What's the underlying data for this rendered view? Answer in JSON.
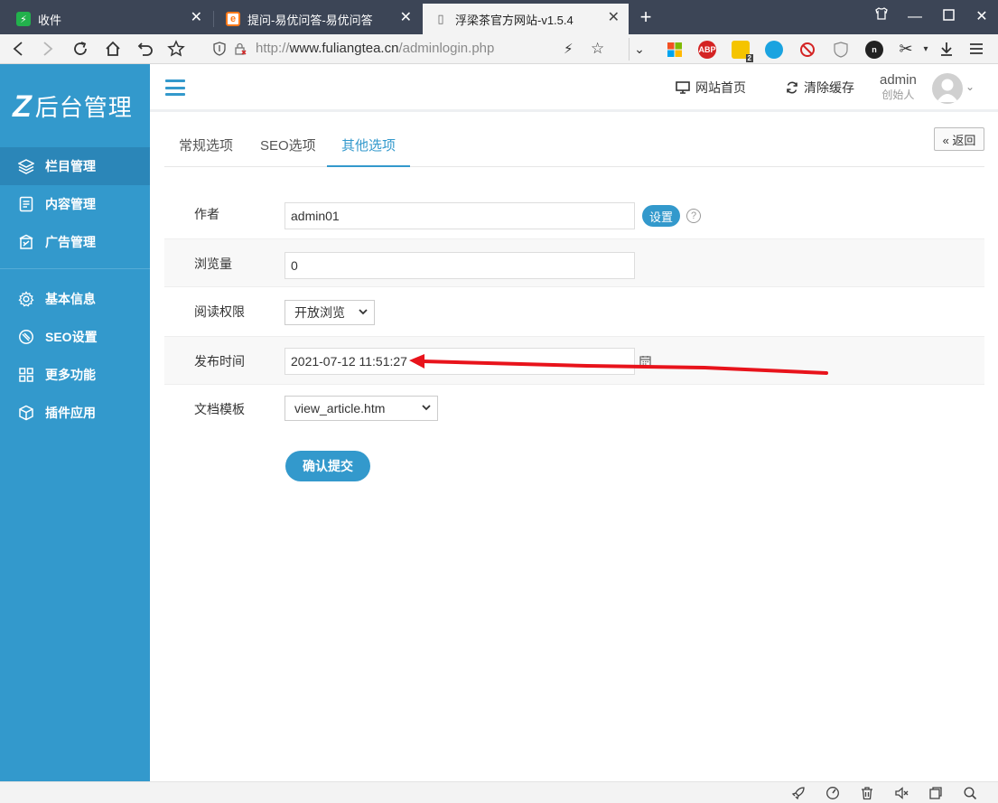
{
  "browser": {
    "tabs": [
      {
        "title": "收件",
        "favicon_color": "#22b14c",
        "favicon_glyph": "⚡"
      },
      {
        "title": "提问-易优问答-易优问答",
        "favicon_color": "#ff7a1a",
        "favicon_glyph": "e"
      },
      {
        "title": "浮梁茶官方网站-v1.5.4",
        "favicon_color": "#ffffff",
        "favicon_glyph": "▯"
      }
    ],
    "url_scheme": "http://",
    "url_host": "www.fuliangtea.cn",
    "url_path": "/adminlogin.php",
    "extensions": [
      {
        "name": "windows-extension-icon",
        "label": "",
        "color": "#e8e8e8"
      },
      {
        "name": "adblock-icon",
        "label": "ABP",
        "color": "#d42323"
      },
      {
        "name": "chat-extension-icon",
        "label": "2",
        "color": "#f5c400"
      },
      {
        "name": "blue-circle-extension-icon",
        "label": "",
        "color": "#1aa3e0"
      },
      {
        "name": "block-extension-icon",
        "label": "",
        "color": "#ffffff"
      },
      {
        "name": "shield-extension-icon",
        "label": "",
        "color": "#ffffff"
      },
      {
        "name": "dark-circle-extension-icon",
        "label": "",
        "color": "#222222"
      }
    ]
  },
  "sidebar": {
    "logo_mark": "Z",
    "logo_text": "后台管理",
    "items": [
      {
        "label": "栏目管理",
        "icon": "layers-icon",
        "active": true
      },
      {
        "label": "内容管理",
        "icon": "document-icon",
        "active": false
      },
      {
        "label": "广告管理",
        "icon": "ad-icon",
        "active": false
      },
      {
        "label": "基本信息",
        "icon": "gear-icon",
        "active": false
      },
      {
        "label": "SEO设置",
        "icon": "seo-icon",
        "active": false
      },
      {
        "label": "更多功能",
        "icon": "grid-icon",
        "active": false
      },
      {
        "label": "插件应用",
        "icon": "plugin-icon",
        "active": false
      }
    ]
  },
  "header": {
    "site_home": "网站首页",
    "clear_cache": "清除缓存",
    "user_name": "admin",
    "user_role": "创始人"
  },
  "content": {
    "tabs": [
      "常规选项",
      "SEO选项",
      "其他选项"
    ],
    "active_tab": 2,
    "back_label": "« 返回",
    "fields": {
      "author_label": "作者",
      "author_value": "admin01",
      "set_button": "设置",
      "views_label": "浏览量",
      "views_value": "0",
      "read_perm_label": "阅读权限",
      "read_perm_value": "开放浏览",
      "publish_time_label": "发布时间",
      "publish_time_value": "2021-07-12 11:51:27",
      "template_label": "文档模板",
      "template_value": "view_article.htm"
    },
    "submit_label": "确认提交"
  },
  "annotation_color": "#e8131b",
  "accent_color": "#3399cc"
}
